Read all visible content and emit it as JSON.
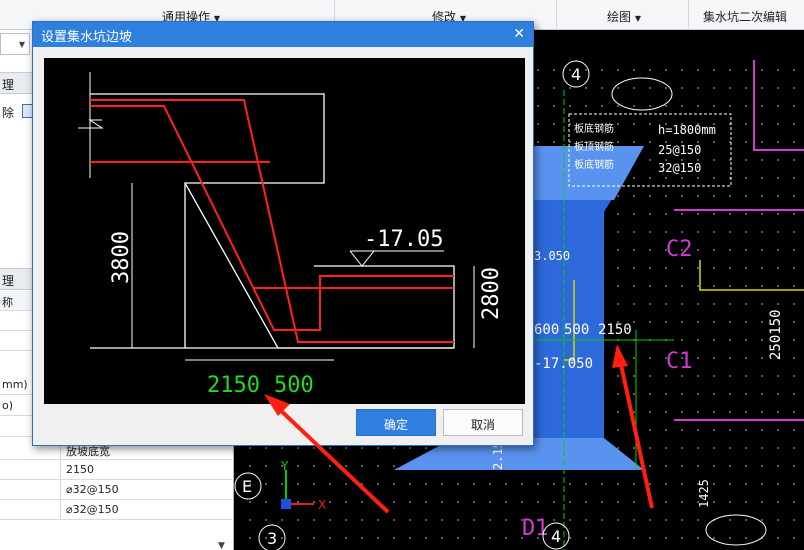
{
  "ribbon": {
    "groups": [
      "通用操作",
      "修改",
      "绘图",
      "集水坑二次编辑"
    ]
  },
  "left_panel": {
    "head_top": "理",
    "tool_label": "除",
    "head_bottom": "理",
    "column_header": "称",
    "rows": [
      {
        "name": "",
        "value": ""
      },
      {
        "name": "",
        "value": ""
      },
      {
        "name": "mm)",
        "value": ""
      },
      {
        "name": "o)",
        "value": ""
      },
      {
        "name": "",
        "value": ""
      },
      {
        "name": "",
        "value": "放坡底宽"
      },
      {
        "name": "",
        "value": "2150"
      },
      {
        "name": "",
        "value": "⌀32@150"
      },
      {
        "name": "",
        "value": "⌀32@150"
      }
    ]
  },
  "dialog": {
    "title": "设置集水坑边坡",
    "ok_label": "确定",
    "cancel_label": "取消",
    "drawing": {
      "elevation": "-17.05",
      "dim_height_left": "3800",
      "dim_height_right": "2800",
      "dim_bottom_slope": "2150",
      "dim_bottom_wall": "500"
    }
  },
  "cad": {
    "note_rows": [
      "板底钢筋",
      "板顶钢筋",
      "板底钢筋"
    ],
    "note_values": [
      "h=1800mm",
      "25@150",
      "32@150"
    ],
    "grid_labels": [
      "4",
      "C2",
      "C1",
      "E",
      "D1",
      "3",
      "4"
    ],
    "dims": [
      "2150",
      "500",
      "600",
      "-17.050",
      "3.050",
      "250150",
      "1425",
      "2.15"
    ],
    "axis_x": "X",
    "axis_y": "Y"
  }
}
